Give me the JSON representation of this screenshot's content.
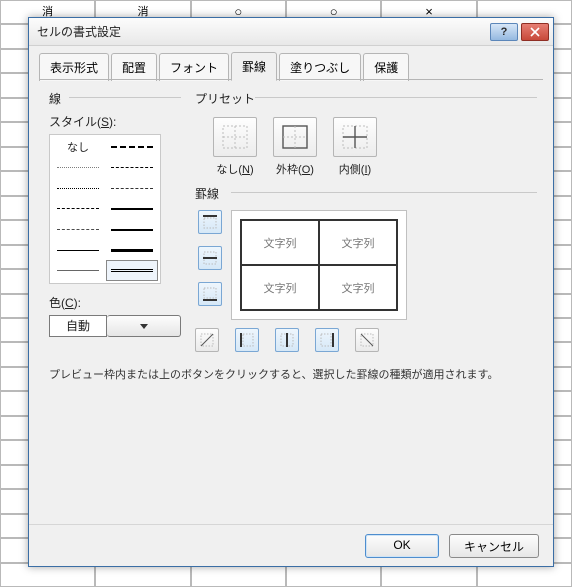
{
  "bg": {
    "row0": [
      "消",
      "消",
      "○",
      "○",
      "×",
      ""
    ],
    "row1": [
      "",
      "",
      "",
      "",
      "",
      ""
    ]
  },
  "dialog": {
    "title": "セルの書式設定",
    "tabs": [
      "表示形式",
      "配置",
      "フォント",
      "罫線",
      "塗りつぶし",
      "保護"
    ],
    "active_tab": 3,
    "section_line": "線",
    "style_label_pre": "スタイル(",
    "style_label_u": "S",
    "style_label_post": "):",
    "none_label": "なし",
    "color_label_pre": "色(",
    "color_label_u": "C",
    "color_label_post": "):",
    "color_value": "自動",
    "preset_section": "プリセット",
    "presets": {
      "none_pre": "なし(",
      "none_u": "N",
      "none_post": ")",
      "outer_pre": "外枠(",
      "outer_u": "O",
      "outer_post": ")",
      "inner_pre": "内側(",
      "inner_u": "I",
      "inner_post": ")"
    },
    "border_section": "罫線",
    "preview_cell": "文字列",
    "description": "プレビュー枠内または上のボタンをクリックすると、選択した罫線の種類が適用されます。",
    "ok": "OK",
    "cancel": "キャンセル"
  }
}
